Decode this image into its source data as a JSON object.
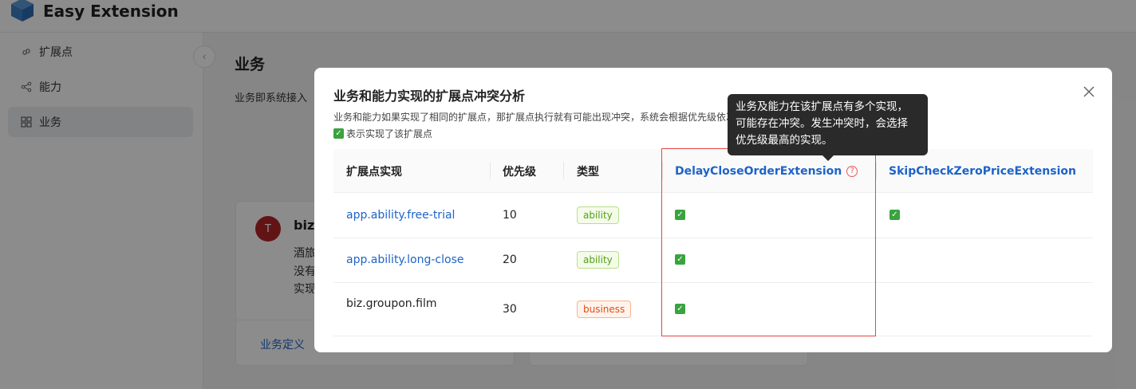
{
  "app": {
    "title": "Easy Extension"
  },
  "sidebar": {
    "items": [
      {
        "label": "扩展点",
        "icon": "link-icon"
      },
      {
        "label": "能力",
        "icon": "share-icon"
      },
      {
        "label": "业务",
        "icon": "grid-icon",
        "active": true
      }
    ]
  },
  "main": {
    "title": "业务",
    "description": "业务即系统接入"
  },
  "card": {
    "avatar": "T",
    "name": "biz.",
    "lines": [
      "酒旅",
      "没有",
      "实现"
    ],
    "link": "业务定义"
  },
  "modal": {
    "title": "业务和能力实现的扩展点冲突分析",
    "description": "业务和能力如果实现了相同的扩展点，那扩展点执行就有可能出现冲突，系统会根据优先级依次",
    "legend_check": "✓",
    "legend_text": "表示实现了该扩展点",
    "columns": {
      "impl": "扩展点实现",
      "priority": "优先级",
      "type": "类型",
      "ext1": "DelayCloseOrderExtension",
      "ext2": "SkipCheckZeroPriceExtension"
    },
    "rows": [
      {
        "impl": "app.ability.free-trial",
        "priority": "10",
        "type": "ability",
        "ext1": "✓",
        "ext2": "✓"
      },
      {
        "impl": "app.ability.long-close",
        "priority": "20",
        "type": "ability",
        "ext1": "✓",
        "ext2": ""
      },
      {
        "impl": "biz.groupon.film",
        "priority": "30",
        "type": "business",
        "ext1": "✓",
        "ext2": ""
      }
    ]
  },
  "tooltip": {
    "lines": [
      "业务及能力在该扩展点有多个实现，",
      "可能存在冲突。发生冲突时，会选择",
      "优先级最高的实现。"
    ]
  },
  "colors": {
    "link": "#1d63c8",
    "check": "#3aa33f",
    "highlight_border": "#e64545",
    "ability_tag": "#52a01b",
    "business_tag": "#e24d15"
  }
}
